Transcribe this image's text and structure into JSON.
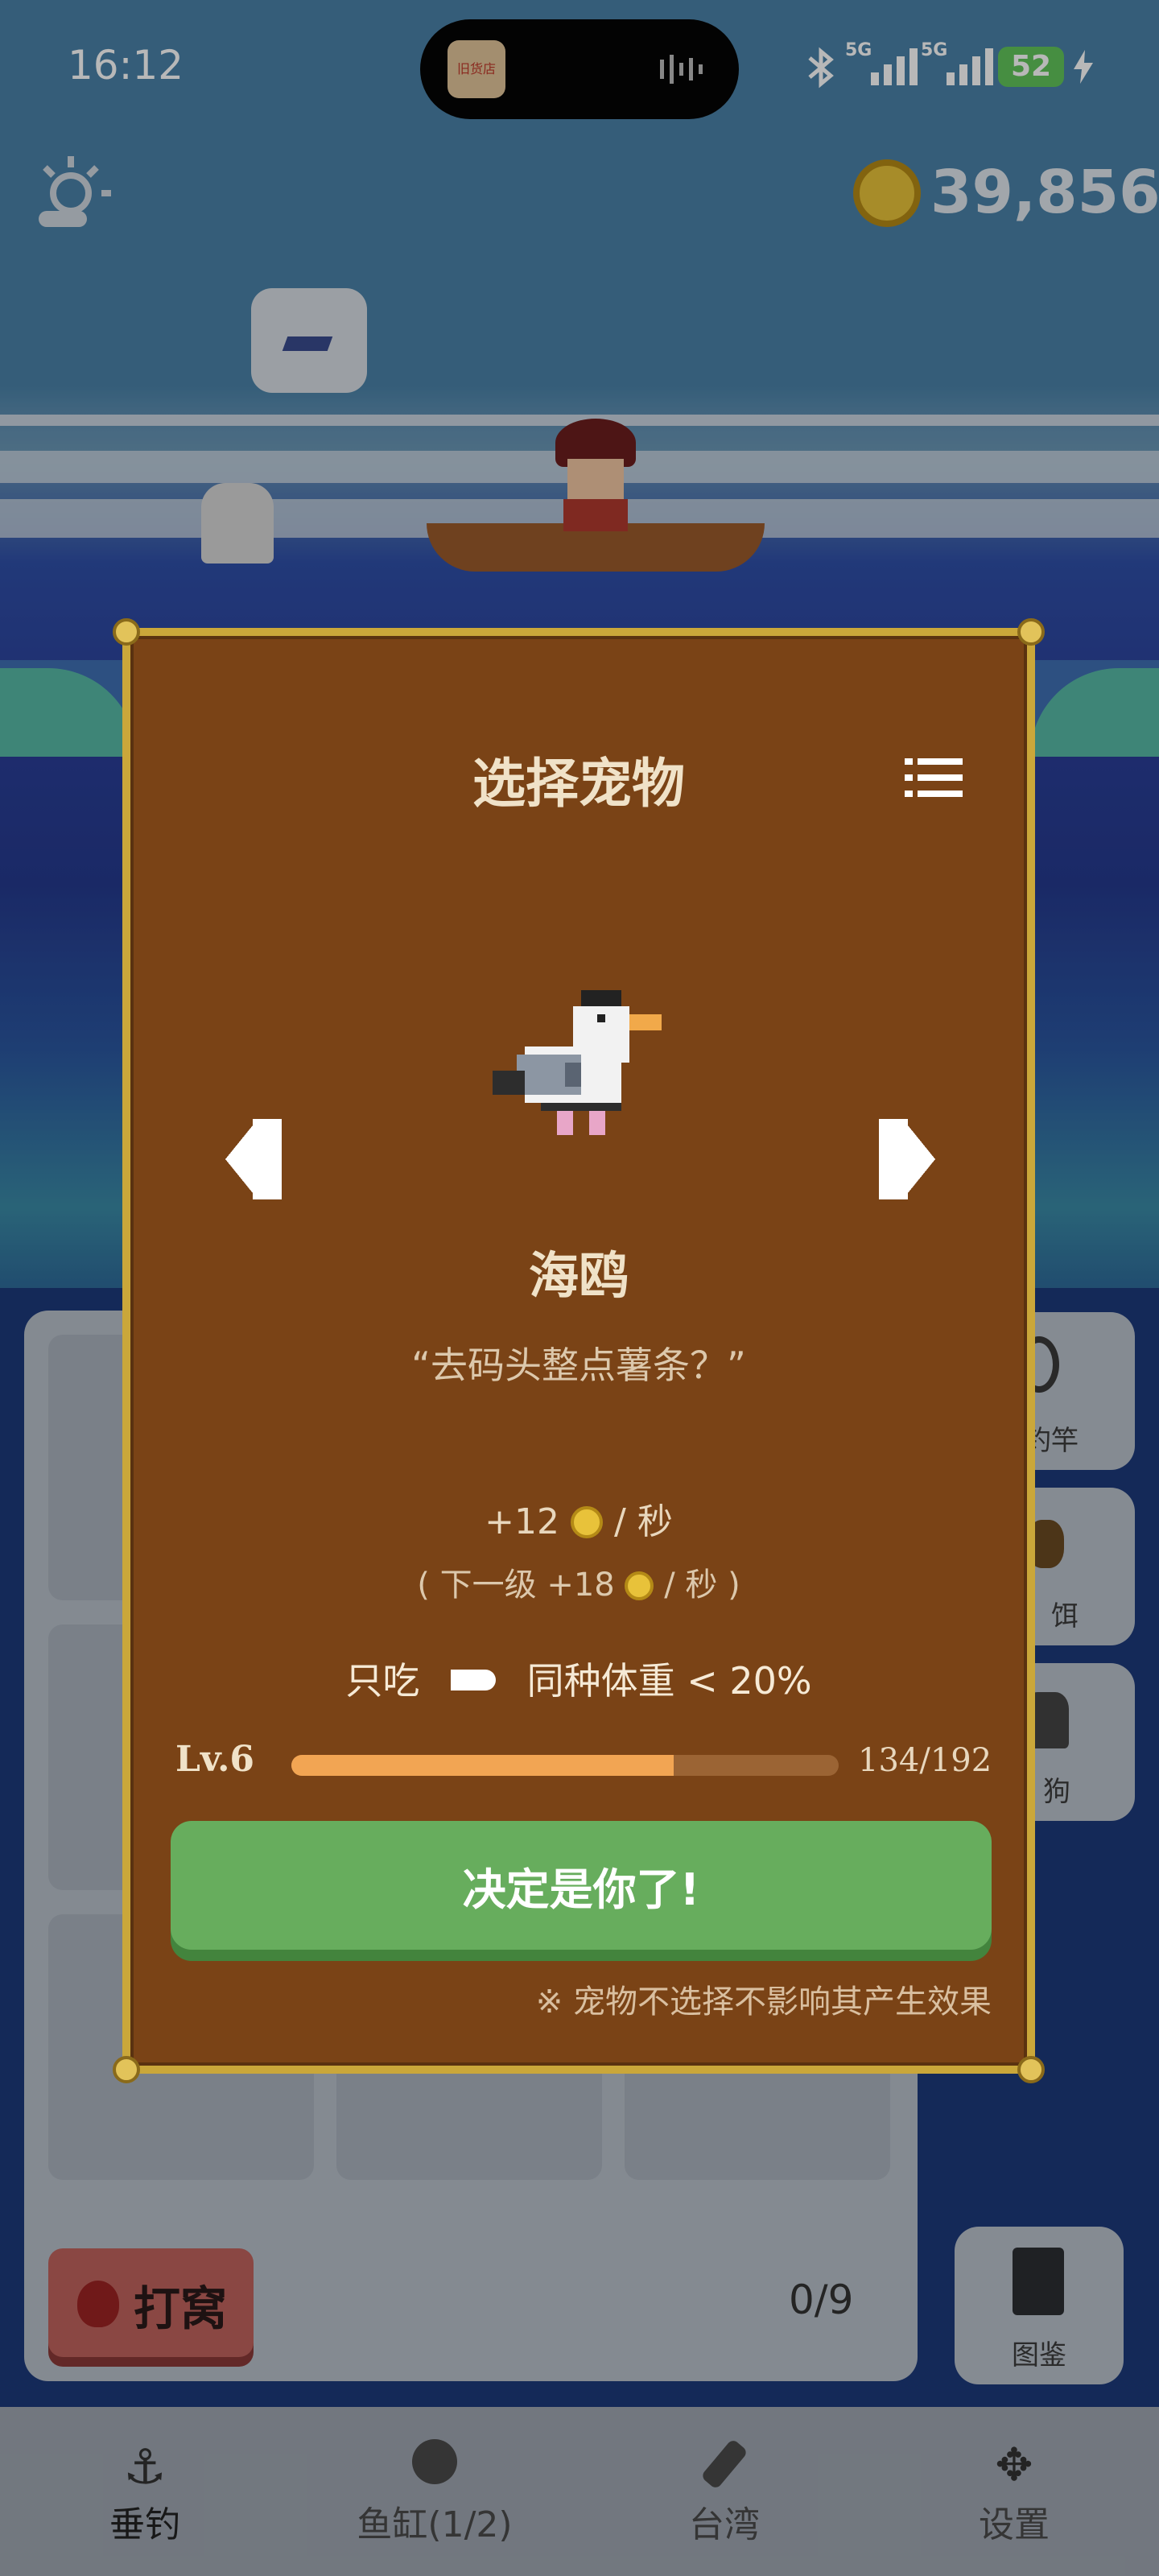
{
  "status_bar": {
    "time": "16:12",
    "network1": "5G",
    "network2": "5G",
    "battery": "52",
    "app_icon_text": "旧货店"
  },
  "hud": {
    "coins": "39,856"
  },
  "modal": {
    "title": "选择宠物",
    "pet_name": "海鸥",
    "pet_quote": "“去码头整点薯条？”",
    "income_amount": "+12",
    "income_unit": "/ 秒",
    "next_level_prefix": "( 下一级 +18",
    "next_level_suffix": "/ 秒 )",
    "diet_label": "只吃",
    "diet_condition": "同种体重 < 20%",
    "level": "Lv.6",
    "progress_text": "134/192",
    "progress_fraction": 0.698,
    "confirm_label": "决定是你了!",
    "note": "※ 宠物不选择不影响其产生效果"
  },
  "side_buttons": [
    {
      "label": "钓竿",
      "icon": "fishing-rod-icon"
    },
    {
      "label": "饵",
      "icon": "bait-icon"
    },
    {
      "label": "狗",
      "icon": "dog-icon"
    }
  ],
  "lower": {
    "nest_button": "打窝",
    "capacity": "0/9",
    "encyclopedia": "图鉴"
  },
  "nav": [
    {
      "label": "垂钓",
      "icon": "hook-icon"
    },
    {
      "label": "鱼缸(1/2)",
      "icon": "fishbowl-icon"
    },
    {
      "label": "台湾",
      "icon": "bottle-icon"
    },
    {
      "label": "设置",
      "icon": "settings-icon"
    }
  ],
  "colors": {
    "modal_bg": "#7a4316",
    "modal_border": "#caa73a",
    "confirm_btn": "#67ad5d",
    "progress_fill": "#f2a553"
  }
}
